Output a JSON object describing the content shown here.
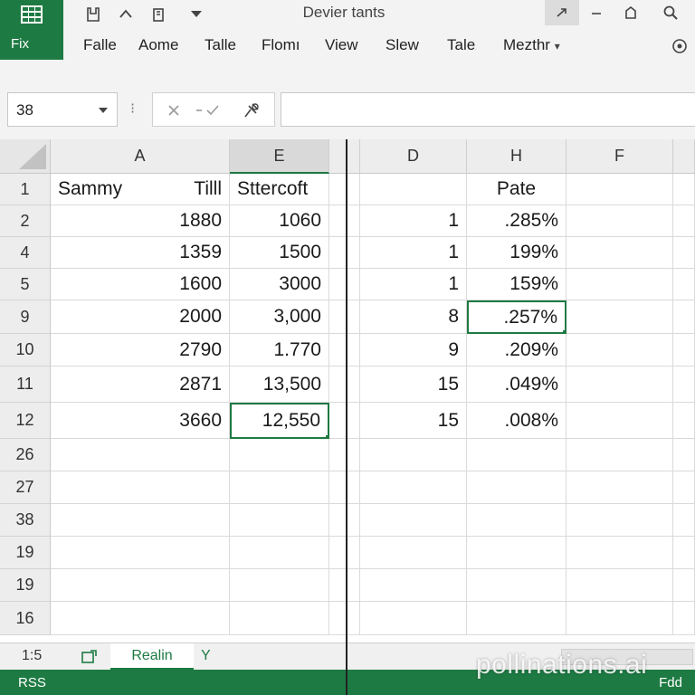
{
  "app": {
    "file_tab": "Fіx",
    "title": "Devier tants"
  },
  "menu": [
    "Falle",
    "Aome",
    "Talle",
    "Flomı",
    "View",
    "Slew",
    "Tale",
    "Mezthr"
  ],
  "formula_bar": {
    "name_box": "38",
    "formula": ""
  },
  "columns": [
    "A",
    "E",
    "D",
    "H",
    "F"
  ],
  "rows": [
    {
      "num": "1",
      "A_left": "Sammy",
      "A_right": "Tilll",
      "E": "Sttercoft",
      "D": "",
      "H": "Pate"
    },
    {
      "num": "2",
      "A_left": "",
      "A_right": "1880",
      "E": "1060",
      "D": "1",
      "H": ".285%"
    },
    {
      "num": "4",
      "A_left": "",
      "A_right": "1359",
      "E": "1500",
      "D": "1",
      "H": "199%"
    },
    {
      "num": "5",
      "A_left": "",
      "A_right": "1600",
      "E": "3000",
      "D": "1",
      "H": "159%"
    },
    {
      "num": "9",
      "A_left": "",
      "A_right": "2000",
      "E": "3,000",
      "D": "8",
      "H": ".257%"
    },
    {
      "num": "10",
      "A_left": "",
      "A_right": "2790",
      "E": "1.770",
      "D": "9",
      "H": ".209%"
    },
    {
      "num": "11",
      "A_left": "",
      "A_right": "2871",
      "E": "13,500",
      "D": "15",
      "H": ".049%"
    },
    {
      "num": "12",
      "A_left": "",
      "A_right": "3660",
      "E": "12,550",
      "D": "15",
      "H": ".008%"
    },
    {
      "num": "26",
      "A_left": "",
      "A_right": "",
      "E": "",
      "D": "",
      "H": ""
    },
    {
      "num": "27",
      "A_left": "",
      "A_right": "",
      "E": "",
      "D": "",
      "H": ""
    },
    {
      "num": "38",
      "A_left": "",
      "A_right": "",
      "E": "",
      "D": "",
      "H": ""
    },
    {
      "num": "19",
      "A_left": "",
      "A_right": "",
      "E": "",
      "D": "",
      "H": ""
    },
    {
      "num": "19",
      "A_left": "",
      "A_right": "",
      "E": "",
      "D": "",
      "H": ""
    },
    {
      "num": "16",
      "A_left": "",
      "A_right": "",
      "E": "",
      "D": "",
      "H": ""
    }
  ],
  "active_cells": [
    "H9",
    "E12"
  ],
  "sheet_tabs": {
    "position": "1:5",
    "active": "Realin",
    "other": "Y"
  },
  "status_bar": {
    "left": "RSS",
    "right": "Fdd"
  },
  "watermark": "pollinations.ai",
  "colors": {
    "accent": "#1e7a43",
    "header_bg": "#ededed",
    "gridline": "#dadada"
  }
}
